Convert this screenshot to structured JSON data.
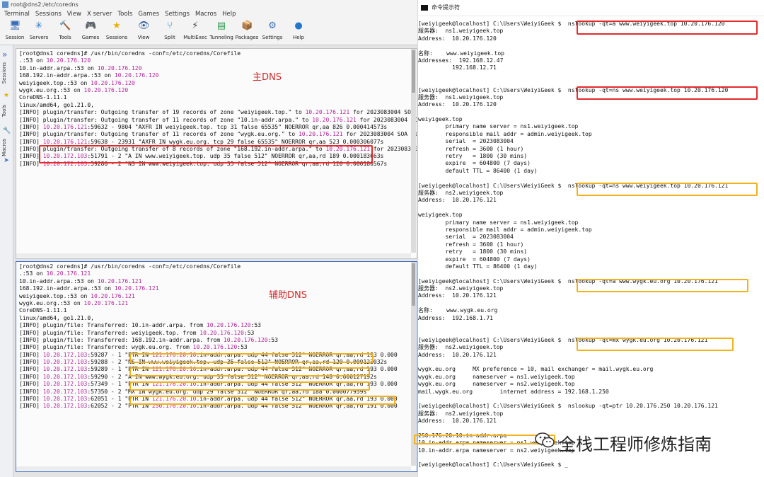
{
  "left": {
    "title": "root@dns2:/etc/coredns",
    "menu": [
      "Terminal",
      "Sessions",
      "View",
      "X server",
      "Tools",
      "Games",
      "Settings",
      "Macros",
      "Help"
    ],
    "toolbar": [
      {
        "label": "Session",
        "icon": "session-icon",
        "glyph": "🖥"
      },
      {
        "label": "Servers",
        "icon": "servers-icon",
        "glyph": "✳"
      },
      {
        "label": "Tools",
        "icon": "tools-icon",
        "glyph": "🔨"
      },
      {
        "label": "Games",
        "icon": "games-icon",
        "glyph": "🎮"
      },
      {
        "label": "Sessions",
        "icon": "sessions-star-icon",
        "glyph": "★"
      },
      {
        "label": "View",
        "icon": "view-icon",
        "glyph": "👁"
      },
      {
        "label": "Split",
        "icon": "split-icon",
        "glyph": "⑂"
      },
      {
        "label": "MultiExec",
        "icon": "multiexec-icon",
        "glyph": "⚡"
      },
      {
        "label": "Tunneling",
        "icon": "tunneling-icon",
        "glyph": "▤"
      },
      {
        "label": "Packages",
        "icon": "packages-icon",
        "glyph": "📦"
      },
      {
        "label": "Settings",
        "icon": "settings-icon",
        "glyph": "⚙"
      },
      {
        "label": "Help",
        "icon": "help-icon",
        "glyph": "●"
      }
    ],
    "sidebar": [
      "Sessions",
      "Tools",
      "Macros"
    ],
    "term1": {
      "note": "主DNS",
      "lines": [
        [
          {
            "t": "[root@dns1 coredns]# /usr/bin/coredns -conf=/etc/coredns/Corefile"
          }
        ],
        [
          {
            "t": ".:53 on "
          },
          {
            "t": "10.20.176.120",
            "c": "m"
          }
        ],
        [
          {
            "t": "10.in-addr.arpa.:53 on "
          },
          {
            "t": "10.20.176.120",
            "c": "m"
          }
        ],
        [
          {
            "t": "168.192.in-addr.arpa.:53 on "
          },
          {
            "t": "10.20.176.120",
            "c": "m"
          }
        ],
        [
          {
            "t": "weiyigeek.top.:53 on "
          },
          {
            "t": "10.20.176.120",
            "c": "m"
          }
        ],
        [
          {
            "t": "wygk.eu.org.:53 on "
          },
          {
            "t": "10.20.176.120",
            "c": "m"
          }
        ],
        [
          {
            "t": "CoreDNS-1.11.1"
          }
        ],
        [
          {
            "t": "linux/amd64, go1.21.0,"
          }
        ],
        [
          {
            "t": "[INFO] plugin/transfer: Outgoing transfer of 19 records of zone \"weiyigeek.top.\" to "
          },
          {
            "t": "10.20.176.121",
            "c": "m"
          },
          {
            "t": " for 2023083004 SOA serial"
          }
        ],
        [
          {
            "t": "[INFO] plugin/transfer: Outgoing transfer of 11 records of zone \"10.in-addr.arpa.\" to "
          },
          {
            "t": "10.20.176.121",
            "c": "m"
          },
          {
            "t": " for 2023083004 SOA serial"
          }
        ],
        [
          {
            "t": "[INFO] "
          },
          {
            "t": "10.20.176.121",
            "c": "m"
          },
          {
            "t": ":59632 - 9804 \"AXFR IN weiyigeek.top. tcp 31 false 65535\" NOERROR qr,aa 826 0.000414573s"
          }
        ],
        [
          {
            "t": "[INFO] plugin/transfer: Outgoing transfer of 11 records of zone \"wygk.eu.org.\" to "
          },
          {
            "t": "10.20.176.121",
            "c": "m"
          },
          {
            "t": " for 2023083004 SOA serial"
          }
        ],
        [
          {
            "t": "[INFO] "
          },
          {
            "t": "10.20.176.121",
            "c": "m"
          },
          {
            "t": ":59638 - 23931 \"AXFR IN wygk.eu.org. tcp 29 false 65535\" NOERROR qr,aa 523 0.000306077s"
          }
        ],
        [
          {
            "t": "[INFO] plugin/transfer: Outgoing transfer of 8 records of zone \"168.192.in-addr.arpa.\" to "
          },
          {
            "t": "10.20.176.121",
            "c": "m"
          },
          {
            "t": " for 2023083004 SOA serial"
          }
        ],
        [
          {
            "t": "[INFO] "
          },
          {
            "t": "10.20.172.103",
            "c": "m"
          },
          {
            "t": ":51791 - 2 \"A IN www.weiyigeek.top. udp 35 false 512\" NOERROR qr,aa,rd 189 0.000183663s"
          }
        ],
        [
          {
            "t": "[INFO] "
          },
          {
            "t": "10.20.172.103",
            "c": "m"
          },
          {
            "t": ":59286 - 2 \"NS IN www.weiyigeek.top. udp 35 false 512\" NOERROR qr,aa,rd 120 0.000180567s"
          }
        ]
      ]
    },
    "term2": {
      "note": "辅助DNS",
      "lines": [
        [
          {
            "t": "[root@dns2 coredns]# /usr/bin/coredns -conf=/etc/coredns/Corefile"
          }
        ],
        [
          {
            "t": ".:53 on "
          },
          {
            "t": "10.20.176.121",
            "c": "m"
          }
        ],
        [
          {
            "t": "10.in-addr.arpa.:53 on "
          },
          {
            "t": "10.20.176.121",
            "c": "m"
          }
        ],
        [
          {
            "t": "168.192.in-addr.arpa.:53 on "
          },
          {
            "t": "10.20.176.121",
            "c": "m"
          }
        ],
        [
          {
            "t": "weiyigeek.top.:53 on "
          },
          {
            "t": "10.20.176.121",
            "c": "m"
          }
        ],
        [
          {
            "t": "wygk.eu.org.:53 on "
          },
          {
            "t": "10.20.176.121",
            "c": "m"
          }
        ],
        [
          {
            "t": "CoreDNS-1.11.1"
          }
        ],
        [
          {
            "t": "linux/amd64, go1.21.0,"
          }
        ],
        [
          {
            "t": "[INFO] plugin/file: Transferred: 10.in-addr.arpa. from "
          },
          {
            "t": "10.20.176.120",
            "c": "m"
          },
          {
            "t": ":53"
          }
        ],
        [
          {
            "t": "[INFO] plugin/file: Transferred: weiyigeek.top. from "
          },
          {
            "t": "10.20.176.120",
            "c": "m"
          },
          {
            "t": ":53"
          }
        ],
        [
          {
            "t": "[INFO] plugin/file: Transferred: 168.192.in-addr.arpa. from "
          },
          {
            "t": "10.20.176.120",
            "c": "m"
          },
          {
            "t": ":53"
          }
        ],
        [
          {
            "t": "[INFO] plugin/file: Transferred: wygk.eu.org. from "
          },
          {
            "t": "10.20.176.120",
            "c": "m"
          },
          {
            "t": ":53"
          }
        ],
        [
          {
            "t": "[INFO] "
          },
          {
            "t": "10.20.172.103",
            "c": "m"
          },
          {
            "t": ":59287 - 1 \"PTR IN "
          },
          {
            "t": "121.176.20.10",
            "c": "m"
          },
          {
            "t": ".in-addr.arpa. udp 44 false 512\" NOERROR qr,aa,rd 193 0.000"
          }
        ],
        [
          {
            "t": "[INFO] "
          },
          {
            "t": "10.20.172.103",
            "c": "m"
          },
          {
            "t": ":59288 - 2 \"NS IN www.weiyigeek.top. udp 35 false 512\" NOERROR qr,aa,rd 120 0.000123032s"
          }
        ],
        [
          {
            "t": "[INFO] "
          },
          {
            "t": "10.20.172.103",
            "c": "m"
          },
          {
            "t": ":59289 - 1 \"PTR IN "
          },
          {
            "t": "121.176.20.10",
            "c": "m"
          },
          {
            "t": ".in-addr.arpa. udp 44 false 512\" NOERROR qr,aa,rd 193 0.000"
          }
        ],
        [
          {
            "t": "[INFO] "
          },
          {
            "t": "10.20.172.103",
            "c": "m"
          },
          {
            "t": ":59290 - 2 \"A IN www.wygk.eu.org. udp 33 false 512\" NOERROR qr,aa,rd 148 0.000127192s"
          }
        ],
        [
          {
            "t": "[INFO] "
          },
          {
            "t": "10.20.172.103",
            "c": "m"
          },
          {
            "t": ":57349 - 1 \"PTR IN "
          },
          {
            "t": "121.176.20.10",
            "c": "m"
          },
          {
            "t": ".in-addr.arpa. udp 44 false 512\" NOERROR qr,aa,rd 193 0.000"
          }
        ],
        [
          {
            "t": "[INFO] "
          },
          {
            "t": "10.20.172.103",
            "c": "m"
          },
          {
            "t": ":57350 - 2 \"MX IN wygk.eu.org. udp 29 false 512\" NOERROR qr,aa,rd 188 0.000077959s"
          }
        ],
        [
          {
            "t": "[INFO] "
          },
          {
            "t": "10.20.172.103",
            "c": "m"
          },
          {
            "t": ":62051 - 1 \"PTR IN "
          },
          {
            "t": "121.176.20.10",
            "c": "m"
          },
          {
            "t": ".in-addr.arpa. udp 44 false 512\" NOERROR qr,aa,rd 193 0.000"
          }
        ],
        [
          {
            "t": "[INFO] "
          },
          {
            "t": "10.20.172.103",
            "c": "m"
          },
          {
            "t": ":62052 - 2 \"PTR IN "
          },
          {
            "t": "250.176.20.10",
            "c": "m"
          },
          {
            "t": ".in-addr.arpa. udp 44 false 512\" NOERROR qr,aa,rd 191 0.000"
          }
        ]
      ]
    }
  },
  "right": {
    "title": "命令提示符",
    "lines": [
      "[weiyigeek@localhost] C:\\Users\\WeiyiGeek $  nslookup -qt=a www.weiyigeek.top 10.20.176.120",
      "服务器:  ns1.weiyigeek.top",
      "Address:  10.20.176.120",
      "",
      "名称:    www.weiyigeek.top",
      "Addresses:  192.168.12.47",
      "          192.168.12.71",
      "",
      "",
      "[weiyigeek@localhost] C:\\Users\\WeiyiGeek $  nslookup -qt=ns www.weiyigeek.top 10.20.176.120",
      "服务器:  ns1.weiyigeek.top",
      "Address:  10.20.176.120",
      "",
      "weiyigeek.top",
      "        primary name server = ns1.weiyigeek.top",
      "        responsible mail addr = admin.weiyigeek.top",
      "        serial  = 2023083004",
      "        refresh = 3600 (1 hour)",
      "        retry   = 1800 (30 mins)",
      "        expire  = 604800 (7 days)",
      "        default TTL = 86400 (1 day)",
      "",
      "[weiyigeek@localhost] C:\\Users\\WeiyiGeek $  nslookup -qt=ns www.weiyigeek.top 10.20.176.121",
      "服务器:  ns2.weiyigeek.top",
      "Address:  10.20.176.121",
      "",
      "weiyigeek.top",
      "        primary name server = ns1.weiyigeek.top",
      "        responsible mail addr = admin.weiyigeek.top",
      "        serial  = 2023083004",
      "        refresh = 3600 (1 hour)",
      "        retry   = 1800 (30 mins)",
      "        expire  = 604800 (7 days)",
      "        default TTL = 86400 (1 day)",
      "",
      "[weiyigeek@localhost] C:\\Users\\WeiyiGeek $  nslookup -qt=a www.wygk.eu.org 10.20.176.121",
      "服务器:  ns2.weiyigeek.top",
      "Address:  10.20.176.121",
      "",
      "名称:    www.wygk.eu.org",
      "Address:  192.168.1.71",
      "",
      "",
      "[weiyigeek@localhost] C:\\Users\\WeiyiGeek $  nslookup -qt=mx wygk.eu.org 10.20.176.121",
      "服务器:  ns2.weiyigeek.top",
      "Address:  10.20.176.121",
      "",
      "wygk.eu.org     MX preference = 10, mail exchanger = mail.wygk.eu.org",
      "wygk.eu.org     nameserver = ns1.weiyigeek.top",
      "wygk.eu.org     nameserver = ns2.weiyigeek.top",
      "mail.wygk.eu.org        internet address = 192.168.1.250",
      "",
      "[weiyigeek@localhost] C:\\Users\\WeiyiGeek $  nslookup -qt=ptr 10.20.176.250 10.20.176.121",
      "服务器:  ns2.weiyigeek.top",
      "Address:  10.20.176.121",
      "",
      "250.176.20.10.in-addr.arpa",
      "10.in-addr.arpa nameserver = ns1.weiyigeek.top",
      "10.in-addr.arpa nameserver = ns2.weiyigeek.top",
      "",
      "[weiyigeek@localhost] C:\\Users\\WeiyiGeek $ _"
    ]
  },
  "watermark": "全栈工程师修炼指南"
}
